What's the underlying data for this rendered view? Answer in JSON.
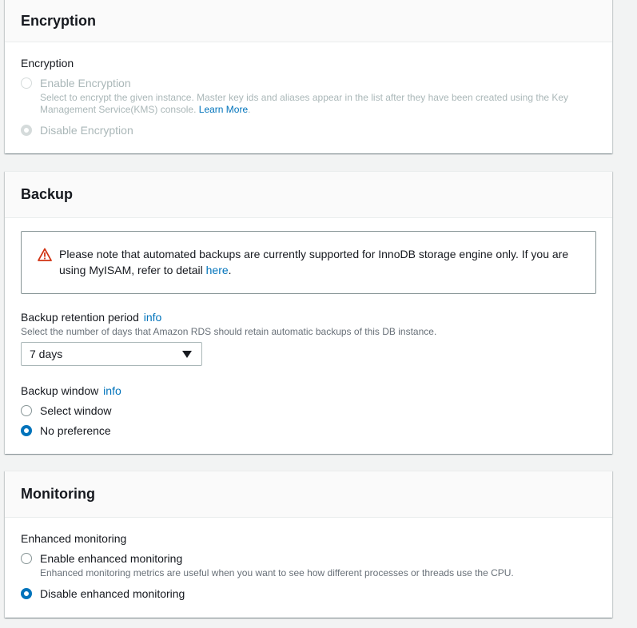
{
  "encryption": {
    "title": "Encryption",
    "field_label": "Encryption",
    "options": [
      {
        "label": "Enable Encryption",
        "description": "Select to encrypt the given instance. Master key ids and aliases appear in the list after they have been created using the Key Management Service(KMS) console.",
        "link": "Learn More",
        "link_suffix": ".",
        "checked": false,
        "disabled": true
      },
      {
        "label": "Disable Encryption",
        "checked": true,
        "disabled": true
      }
    ]
  },
  "backup": {
    "title": "Backup",
    "alert": {
      "text": "Please note that automated backups are currently supported for InnoDB storage engine only. If you are using MyISAM, refer to detail",
      "link": "here",
      "suffix": "."
    },
    "retention": {
      "label": "Backup retention period",
      "info": "info",
      "description": "Select the number of days that Amazon RDS should retain automatic backups of this DB instance.",
      "selected": "7 days"
    },
    "window": {
      "label": "Backup window",
      "info": "info",
      "options": [
        {
          "label": "Select window",
          "checked": false
        },
        {
          "label": "No preference",
          "checked": true
        }
      ]
    }
  },
  "monitoring": {
    "title": "Monitoring",
    "field_label": "Enhanced monitoring",
    "options": [
      {
        "label": "Enable enhanced monitoring",
        "description": "Enhanced monitoring metrics are useful when you want to see how different processes or threads use the CPU.",
        "checked": false
      },
      {
        "label": "Disable enhanced monitoring",
        "checked": true
      }
    ]
  },
  "colors": {
    "accent": "#0073bb",
    "warning": "#d13212",
    "disabled": "#aab7b8"
  }
}
